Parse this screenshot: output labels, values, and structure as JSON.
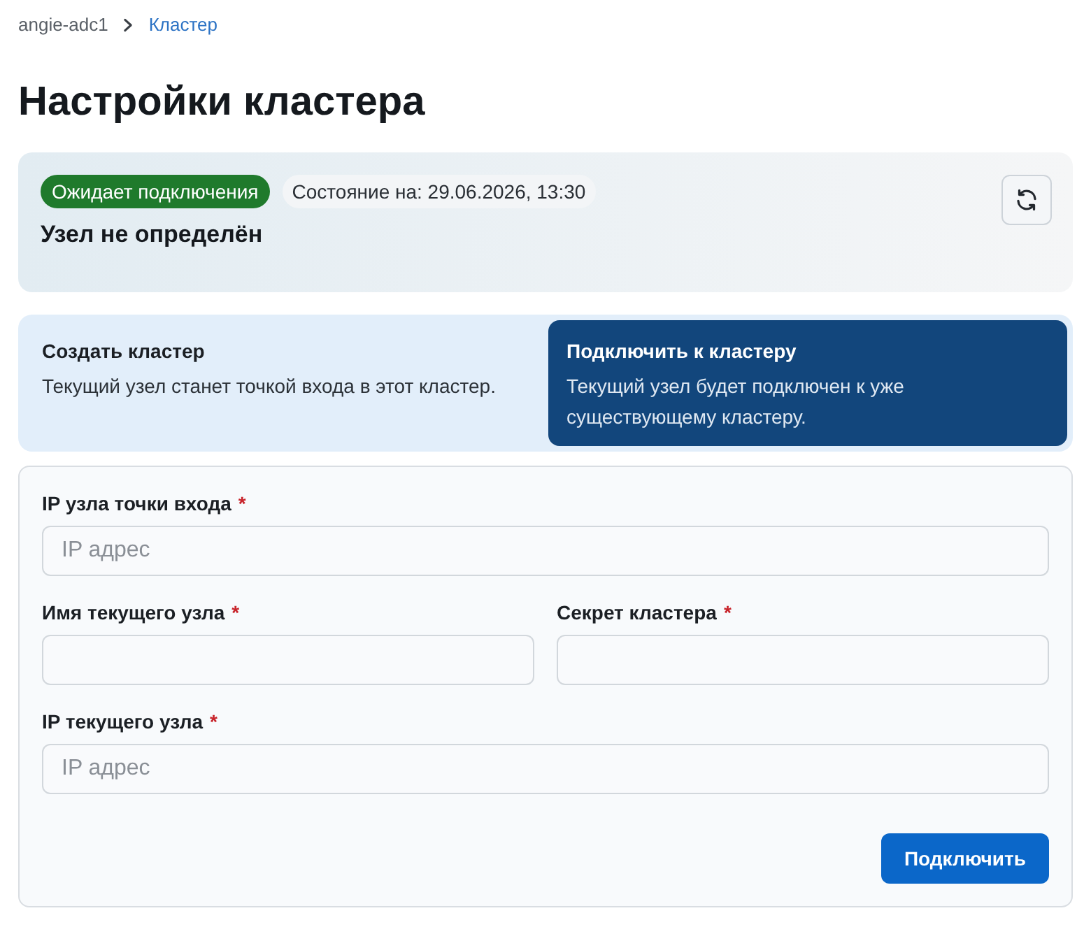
{
  "breadcrumbs": [
    {
      "label": "angie-adc1",
      "current": false
    },
    {
      "label": "Кластер",
      "current": true
    }
  ],
  "title": "Настройки кластера",
  "status": {
    "badge": "Ожидает подключения",
    "timestamp": "Состояние на: 29.06.2026, 13:30",
    "node": "Узел не определён"
  },
  "modes": [
    {
      "title": "Создать кластер",
      "description": "Текущий узел станет точкой входа в этот кластер.",
      "selected": false
    },
    {
      "title": "Подключить к кластеру",
      "description": "Текущий узел будет подключен к уже существующему кластеру.",
      "selected": true
    }
  ],
  "form": {
    "rows": [
      [
        {
          "label": "IP узла точки входа",
          "mark": "*",
          "placeholder": "IP адрес"
        }
      ],
      [
        {
          "label": "Имя текущего узла",
          "mark": "*"
        },
        {
          "label": "Секрет кластера",
          "mark": "*"
        }
      ],
      [
        {
          "label": "IP текущего узла",
          "mark": "*",
          "placeholder": "IP адрес"
        }
      ]
    ],
    "submit": "Подключить"
  }
}
